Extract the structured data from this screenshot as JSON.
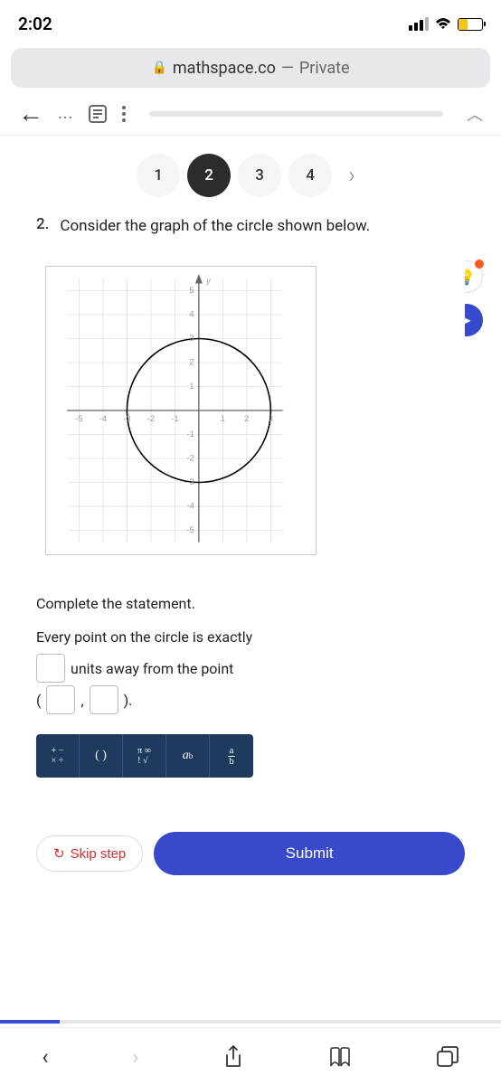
{
  "status": {
    "time": "2:02"
  },
  "url": {
    "domain": "mathspace.co",
    "mode": "Private"
  },
  "nav": {
    "items": [
      "1",
      "2",
      "3",
      "4"
    ],
    "active_index": 1
  },
  "question": {
    "number": "2.",
    "text": "Consider the graph of the circle shown below.",
    "statement_title": "Complete the statement.",
    "statement_line1_a": "Every point on the circle is exactly",
    "statement_line1_b": "units away from the point",
    "paren_open": "(",
    "comma": ",",
    "paren_close": ").",
    "math_toolbar": {
      "ops": "+−\n×÷",
      "parens": "( )",
      "pi_sqrt": "π∞\n!√",
      "power": "a",
      "power_sup": "b",
      "frac_top": "a",
      "frac_bot": "b"
    }
  },
  "chart_data": {
    "type": "scatter",
    "title": "",
    "xlabel": "",
    "ylabel": "y",
    "xlim": [
      -5,
      3.5
    ],
    "ylim": [
      -5.5,
      5.5
    ],
    "x_ticks": [
      -5,
      -4,
      -3,
      -2,
      -1,
      1,
      2,
      3
    ],
    "y_ticks": [
      -5,
      -4,
      -3,
      -2,
      -1,
      1,
      2,
      3,
      4,
      5
    ],
    "shapes": [
      {
        "type": "circle",
        "center_x": 0,
        "center_y": 0,
        "radius": 3
      }
    ]
  },
  "actions": {
    "skip": "Skip step",
    "submit": "Submit"
  }
}
